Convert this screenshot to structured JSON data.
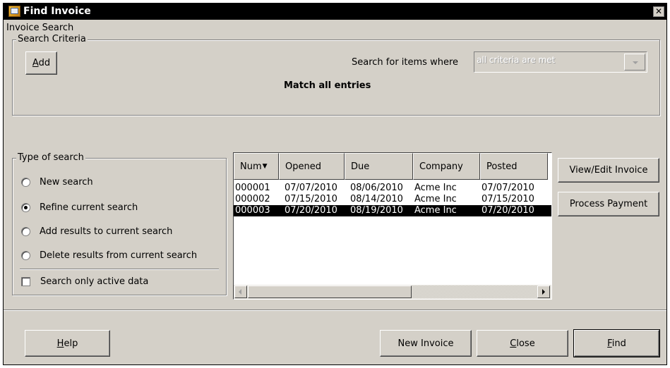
{
  "window": {
    "title": "Find Invoice",
    "close_glyph": "✕"
  },
  "heading": "Invoice Search",
  "search_criteria": {
    "legend": "Search Criteria",
    "add_label_mn": "A",
    "add_label_rest": "dd",
    "search_for_label": "Search for items where",
    "criteria_select_value": "all criteria are met",
    "match_text": "Match all entries"
  },
  "type_of_search": {
    "legend": "Type of search",
    "options": [
      {
        "label": "New search",
        "selected": false
      },
      {
        "label": "Refine current search",
        "selected": true
      },
      {
        "label": "Add results to current search",
        "selected": false
      },
      {
        "label": "Delete results from current search",
        "selected": false
      }
    ],
    "active_only_label": "Search only active data",
    "active_only_checked": false
  },
  "results_table": {
    "columns": [
      "Num",
      "Opened",
      "Due",
      "Company",
      "Posted"
    ],
    "sort_column": "Num",
    "sort_glyph": "▼",
    "rows": [
      [
        "000001",
        "07/07/2010",
        "08/06/2010",
        "Acme Inc",
        "07/07/2010"
      ],
      [
        "000002",
        "07/15/2010",
        "08/14/2010",
        "Acme Inc",
        "07/15/2010"
      ],
      [
        "000003",
        "07/20/2010",
        "08/19/2010",
        "Acme Inc",
        "07/20/2010"
      ]
    ],
    "selected_row": 2
  },
  "side_buttons": {
    "view_edit": "View/Edit Invoice",
    "process_payment": "Process Payment"
  },
  "bottom_buttons": {
    "help_mn": "H",
    "help_rest": "elp",
    "new_invoice": "New Invoice",
    "close_mn": "C",
    "close_rest": "lose",
    "find_mn": "F",
    "find_rest": "ind"
  },
  "colors": {
    "titlebar": "#000000",
    "window_bg": "#d4d0c8",
    "selection": "#000000"
  }
}
